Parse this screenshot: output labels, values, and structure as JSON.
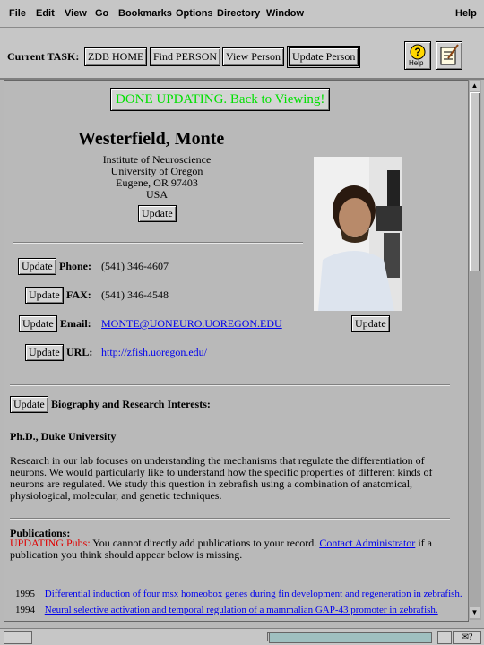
{
  "menu": [
    "File",
    "Edit",
    "View",
    "Go",
    "Bookmarks",
    "Options",
    "Directory",
    "Window"
  ],
  "menu_help": "Help",
  "toolbar": {
    "task_label": "Current TASK:",
    "buttons": [
      "ZDB HOME",
      "Find PERSON",
      "View Person",
      "Update Person"
    ],
    "help_label": "Help"
  },
  "done_button": "DONE UPDATING. Back to Viewing!",
  "person": {
    "name": "Westerfield, Monte",
    "address": [
      "Institute of Neuroscience",
      "University of Oregon",
      "Eugene, OR 97403",
      "USA"
    ]
  },
  "update_label": "Update",
  "contact": {
    "phone_label": "Phone:",
    "phone": "(541) 346-4607",
    "fax_label": "FAX:",
    "fax": "(541) 346-4548",
    "email_label": "Email:",
    "email": "MONTE@UONEURO.UOREGON.EDU",
    "url_label": "URL:",
    "url": "http://zfish.uoregon.edu/"
  },
  "bio": {
    "heading": "Biography and Research Interests:",
    "degree": "Ph.D., Duke University",
    "text": "Research in our lab focuses on understanding the mechanisms that regulate the differentiation of neurons. We would particularly like to understand how the specific properties of different kinds of neurons are regulated. We study this question in zebrafish using a combination of anatomical, physiological, molecular, and genetic techniques."
  },
  "pubs": {
    "heading": "Publications:",
    "updating": "UPDATING Pubs:",
    "notice": " You cannot directly add publications to your record. ",
    "contact_link": "Contact Administrator",
    "notice_end": " if a publication you think should appear below is missing.",
    "items": [
      {
        "year": "1995",
        "title": "Differential induction of four msx homeobox genes during fin development and regeneration in zebrafish."
      },
      {
        "year": "1994",
        "title": "Neural selective activation and temporal regulation of a mammalian GAP-43 promoter in zebrafish."
      }
    ]
  },
  "colors": {
    "done_text": "#00e000",
    "updating_red": "#e00000",
    "link": "#0000ee"
  }
}
